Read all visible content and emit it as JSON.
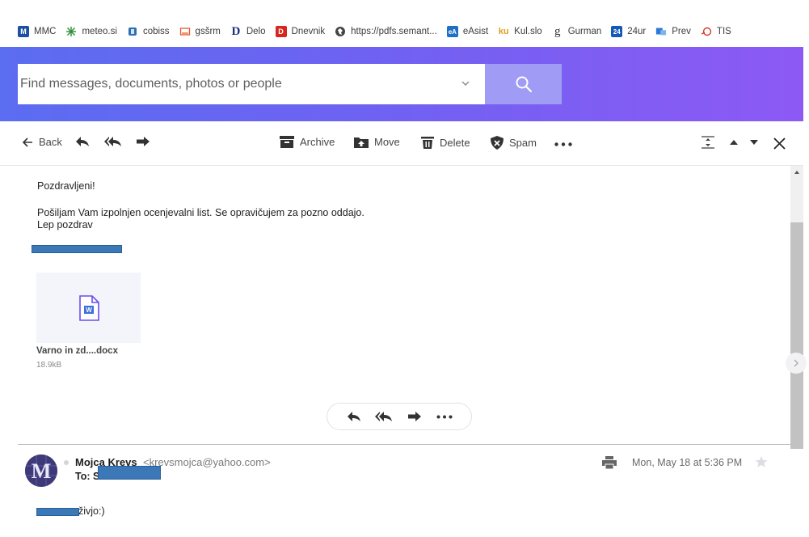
{
  "bookmarks": [
    {
      "label": "MMC",
      "icon": "mmc-icon",
      "color": "#1e4fa3"
    },
    {
      "label": "meteo.si",
      "icon": "meteo-icon",
      "color": "#2a8f3a"
    },
    {
      "label": "cobiss",
      "icon": "cobiss-icon",
      "color": "#2d6fb3"
    },
    {
      "label": "gsšrm",
      "icon": "gssrm-icon",
      "color": "#e45a2c"
    },
    {
      "label": "Delo",
      "icon": "delo-icon",
      "color": "#1a2f7a"
    },
    {
      "label": "Dnevnik",
      "icon": "dnevnik-icon",
      "color": "#d8261f"
    },
    {
      "label": "https://pdfs.semant...",
      "icon": "globe-icon",
      "color": "#444444"
    },
    {
      "label": "eAsist",
      "icon": "easist-icon",
      "color": "#1f6fc5"
    },
    {
      "label": "Kul.slo",
      "icon": "kulslo-icon",
      "color": "#e0a020"
    },
    {
      "label": "Gurman",
      "icon": "gurman-icon",
      "color": "#333333"
    },
    {
      "label": "24ur",
      "icon": "24ur-icon",
      "color": "#1559b8"
    },
    {
      "label": "Prev",
      "icon": "prev-icon",
      "color": "#2a7ad6"
    },
    {
      "label": "TIS",
      "icon": "tis-icon",
      "color": "#d83a2a"
    }
  ],
  "bookmark_badges": {
    "mmc": "M",
    "delo": "D",
    "dnevnik": "D",
    "easist": "eA",
    "kulslo": "ku",
    "gurman": "g",
    "24ur": "24"
  },
  "search": {
    "placeholder": "Find messages, documents, photos or people"
  },
  "toolbar": {
    "back": "Back",
    "archive": "Archive",
    "move": "Move",
    "delete": "Delete",
    "spam": "Spam"
  },
  "message": {
    "greeting": "Pozdravljeni!",
    "line1": "Pošiljam Vam izpolnjen ocenjevalni list. Se opravičujem za pozno oddajo.",
    "line2": "Lep pozdrav"
  },
  "attachment": {
    "name": "Varno in zd....docx",
    "size": "18.9kB"
  },
  "message2": {
    "sender": "Mojca Krevs",
    "email": "<krevsmojca@yahoo.com>",
    "to": "To: S",
    "date": "Mon, May 18 at 5:36 PM",
    "greeting": "živjo:)",
    "avatar_letter": "M"
  },
  "colors": {
    "accent": "#6e62f2",
    "search_button": "#a09bf5",
    "redaction": "#3a78b8"
  }
}
